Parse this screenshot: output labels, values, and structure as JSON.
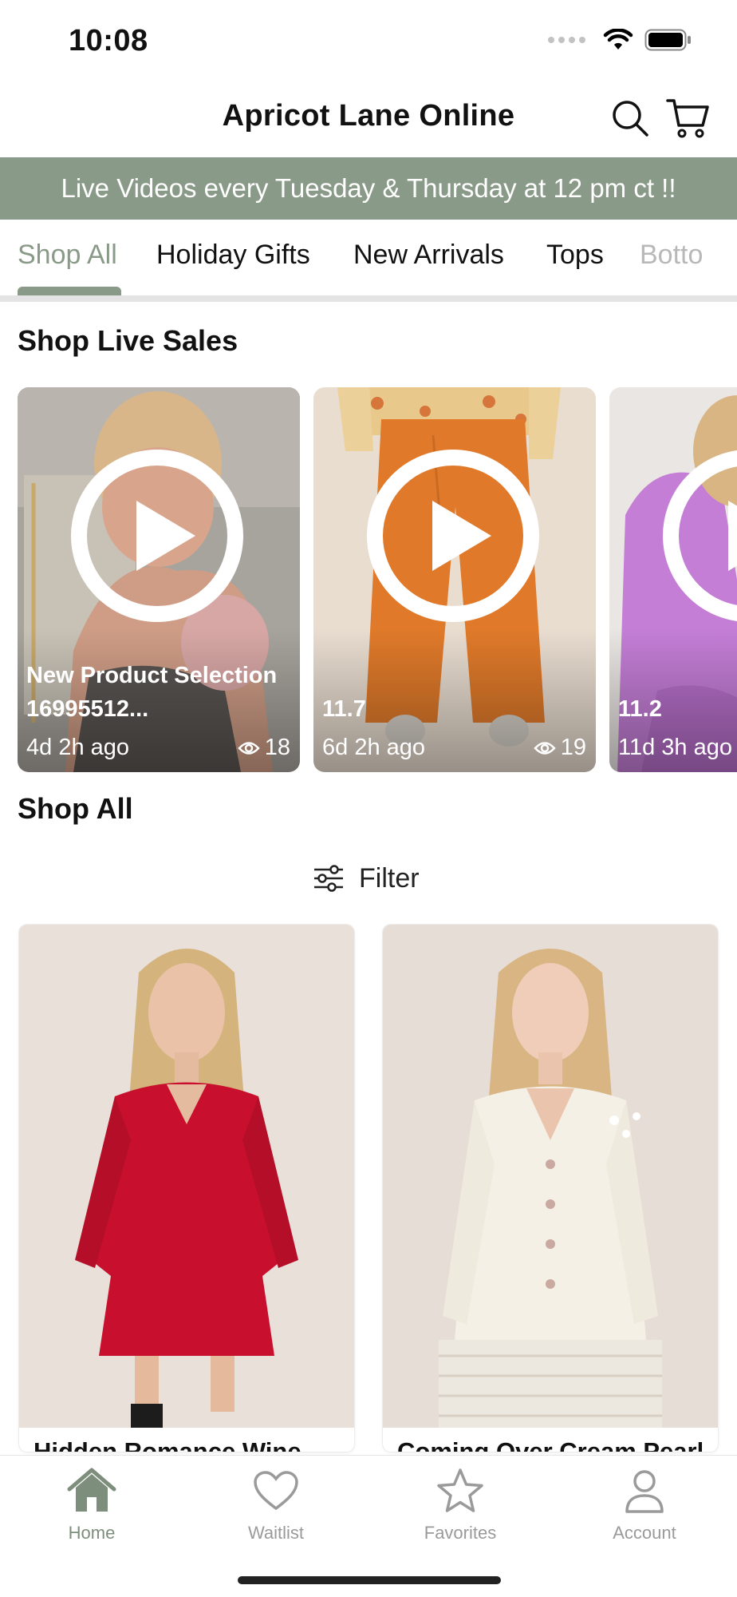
{
  "status_bar": {
    "time": "10:08"
  },
  "header": {
    "title": "Apricot Lane Online"
  },
  "banner": {
    "text": "Live Videos every Tuesday & Thursday at 12 pm ct !!"
  },
  "tabs": [
    {
      "label": "Shop All",
      "active": true
    },
    {
      "label": "Holiday Gifts",
      "active": false
    },
    {
      "label": "New Arrivals",
      "active": false
    },
    {
      "label": "Tops",
      "active": false
    },
    {
      "label": "Botto",
      "active": false
    }
  ],
  "live_section": {
    "title": "Shop Live Sales",
    "videos": [
      {
        "title": "New Product Selection 16995512...",
        "time_ago": "4d 2h ago",
        "views": "18"
      },
      {
        "title": "11.7",
        "time_ago": "6d 2h ago",
        "views": "19"
      },
      {
        "title": "11.2",
        "time_ago": "11d 3h ago",
        "views": ""
      }
    ]
  },
  "shop_section": {
    "title": "Shop All",
    "filter_label": "Filter",
    "products": [
      {
        "name": "Hidden Romance Wine"
      },
      {
        "name": "Coming Over Cream Pearl"
      }
    ]
  },
  "bottom_nav": [
    {
      "label": "Home",
      "icon": "home-icon",
      "active": true
    },
    {
      "label": "Waitlist",
      "icon": "heart-icon",
      "active": false
    },
    {
      "label": "Favorites",
      "icon": "star-icon",
      "active": false
    },
    {
      "label": "Account",
      "icon": "person-icon",
      "active": false
    }
  ],
  "colors": {
    "accent": "#8a9a88",
    "nav_active": "#7e8e7c",
    "inactive": "#9a9a9a"
  }
}
